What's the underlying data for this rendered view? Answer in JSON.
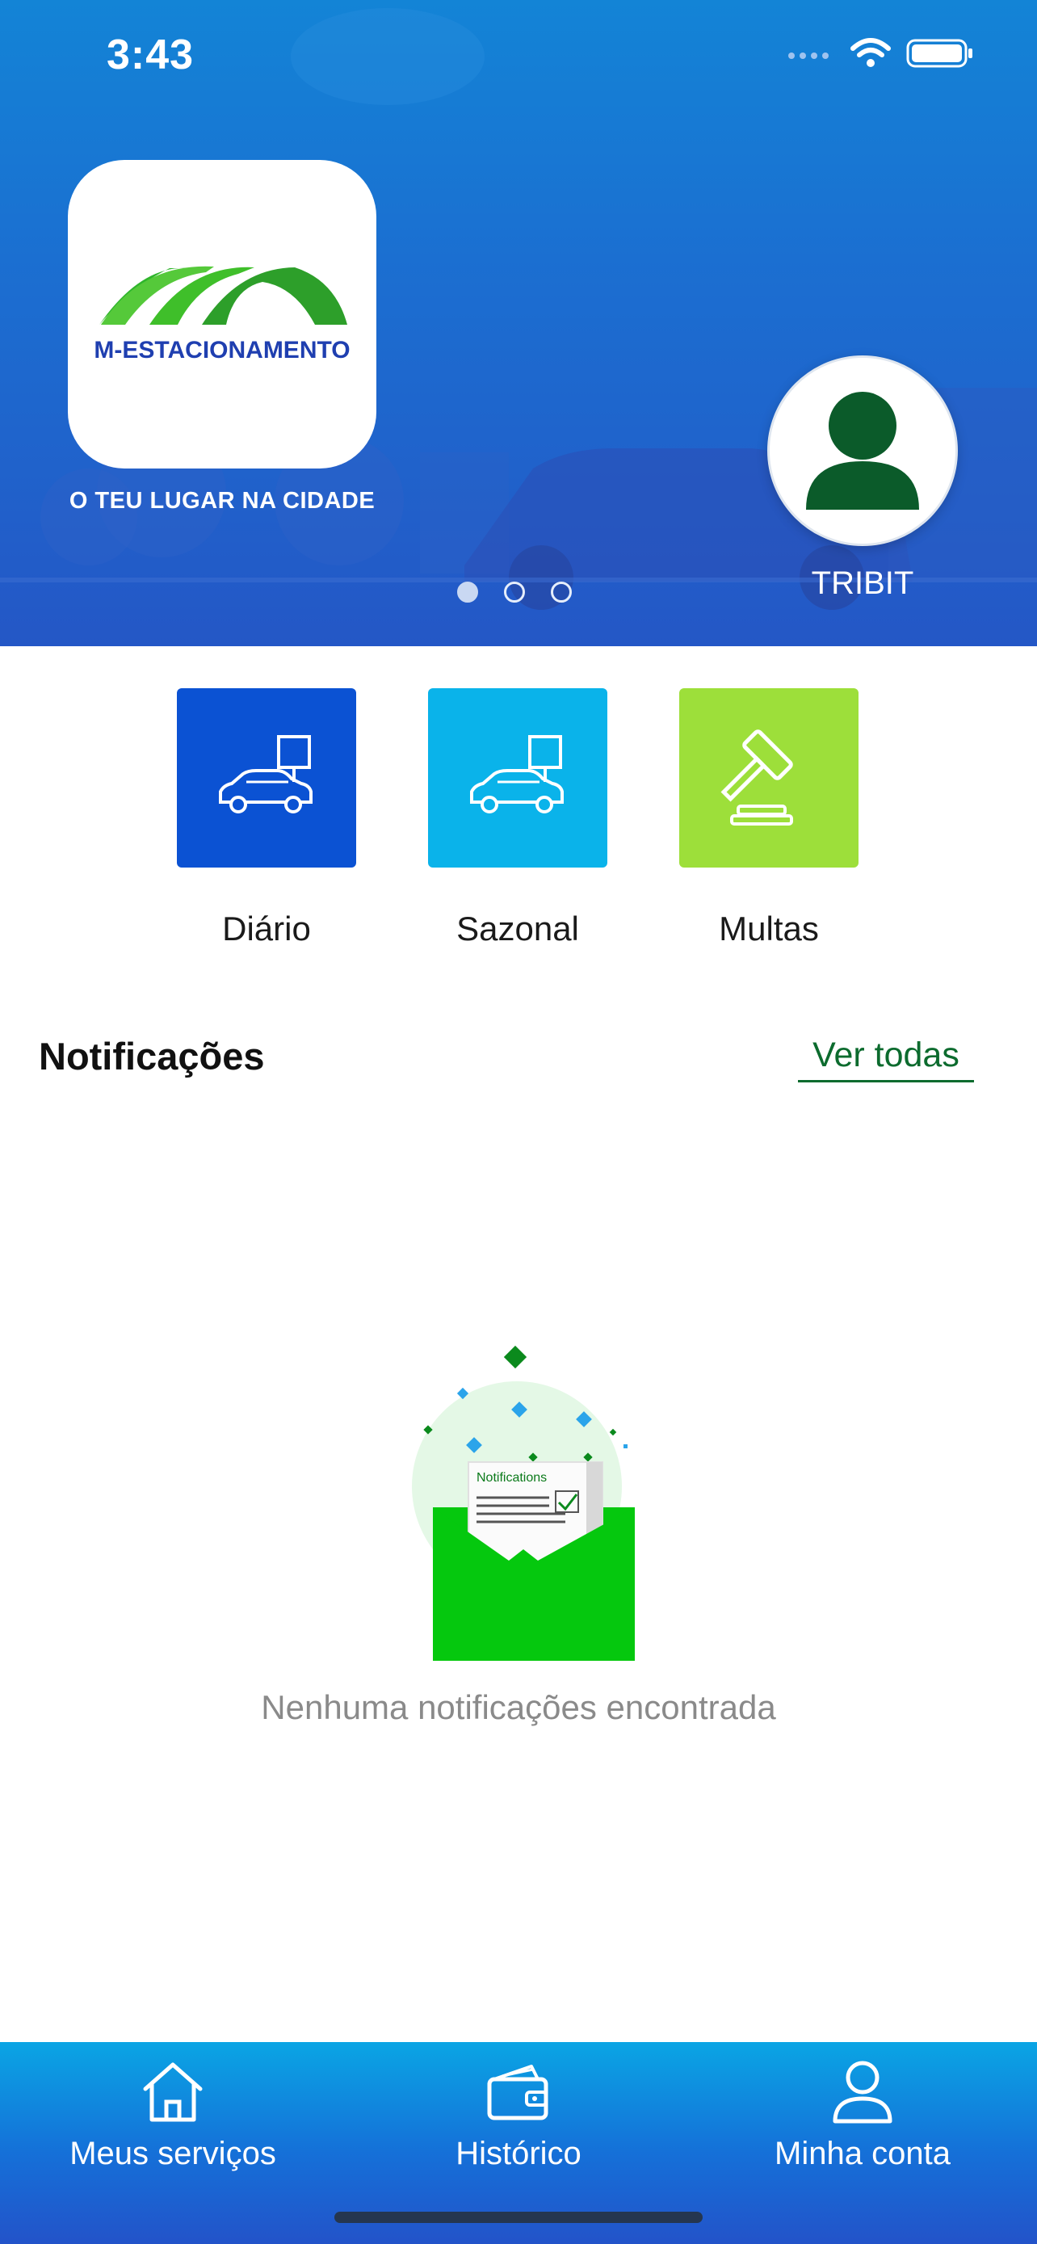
{
  "status_bar": {
    "time": "3:43"
  },
  "hero": {
    "logo_text": "M-ESTACIONAMENTO",
    "tagline": "O TEU LUGAR NA CIDADE",
    "carousel_pages": 3,
    "active_page": 1,
    "user_name": "TRIBIT"
  },
  "services": [
    {
      "label": "Diário",
      "icon": "parked-car-sign-icon",
      "color": "#0b52d3"
    },
    {
      "label": "Sazonal",
      "icon": "parked-car-sign-icon",
      "color": "#0ab3ea"
    },
    {
      "label": "Multas",
      "icon": "gavel-icon",
      "color": "#9ddf3a"
    }
  ],
  "notifications": {
    "title": "Notificações",
    "see_all": "Ver todas",
    "illustration_caption": "Notifications",
    "empty_text": "Nenhuma notificações encontrada"
  },
  "bottom_nav": [
    {
      "label": "Meus serviços",
      "icon": "home-icon"
    },
    {
      "label": "Histórico",
      "icon": "wallet-icon"
    },
    {
      "label": "Minha conta",
      "icon": "user-icon"
    }
  ],
  "colors": {
    "brand_blue": "#1f3fb0",
    "brand_green": "#3fbf2a",
    "link_green": "#0c6b2e",
    "avatar_green": "#0b5b2a"
  }
}
